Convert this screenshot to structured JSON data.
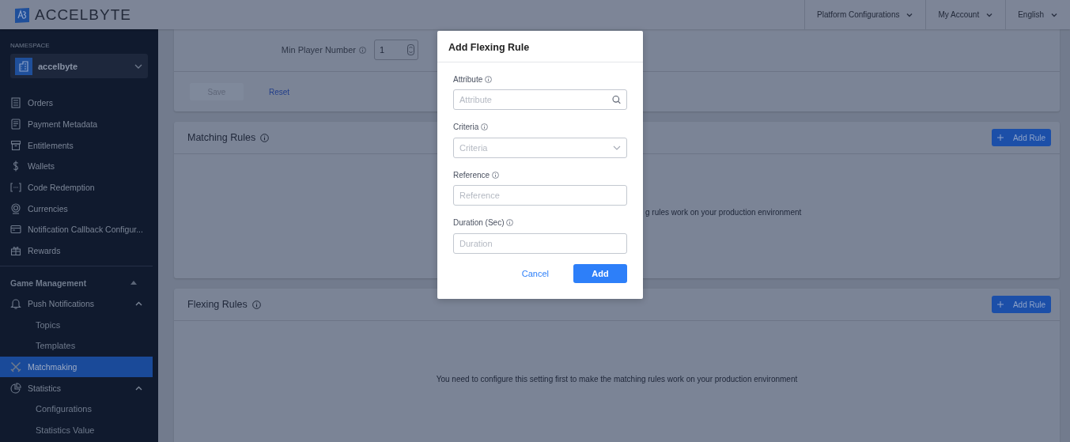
{
  "header": {
    "logo": "ACCELBYTE",
    "menus": [
      {
        "label": "Platform Configurations"
      },
      {
        "label": "My Account"
      },
      {
        "label": "English"
      }
    ]
  },
  "sidebar": {
    "namespace": {
      "label": "NAMESPACE",
      "value": "accelbyte"
    },
    "items": [
      {
        "label": "Orders",
        "selected": false
      },
      {
        "label": "Payment Metadata",
        "selected": false
      },
      {
        "label": "Entitlements",
        "selected": false
      },
      {
        "label": "Wallets",
        "selected": false
      },
      {
        "label": "Code Redemption",
        "selected": false
      },
      {
        "label": "Currencies",
        "selected": false
      },
      {
        "label": "Notification Callback Configur...",
        "selected": false
      },
      {
        "label": "Rewards",
        "selected": false
      }
    ],
    "group": {
      "title": "Game Management",
      "expanded": true,
      "items": [
        {
          "label": "Push Notifications",
          "selected": false,
          "expanded": true,
          "children": [
            {
              "label": "Topics",
              "selected": false
            },
            {
              "label": "Templates",
              "selected": false
            }
          ]
        },
        {
          "label": "Matchmaking",
          "selected": true
        },
        {
          "label": "Statistics",
          "selected": false,
          "expanded": true,
          "children": [
            {
              "label": "Configurations",
              "selected": false
            },
            {
              "label": "Statistics Value",
              "selected": false
            }
          ]
        }
      ]
    }
  },
  "player_settings": {
    "fields": [
      {
        "label": "Min Player Number",
        "value": "1"
      }
    ],
    "save": {
      "label": "Save",
      "disabled": true
    },
    "reset": "Reset"
  },
  "matching_rules": {
    "title": "Matching Rules",
    "add_button": "Add Rule",
    "message": "g rules work on your production environment"
  },
  "flexing_rules": {
    "title": "Flexing Rules",
    "add_button": "Add Rule",
    "message": "You need to configure this setting first to make the matching rules work on your production environment"
  },
  "modal": {
    "title": "Add Flexing Rule",
    "fields": [
      {
        "kind": "search",
        "label": "Attribute",
        "placeholder": "Attribute"
      },
      {
        "kind": "select",
        "label": "Criteria",
        "placeholder": "Criteria"
      },
      {
        "kind": "text",
        "label": "Reference",
        "placeholder": "Reference"
      },
      {
        "kind": "text",
        "label": "Duration (Sec)",
        "placeholder": "Duration"
      }
    ],
    "cancel": "Cancel",
    "submit": "Add"
  }
}
